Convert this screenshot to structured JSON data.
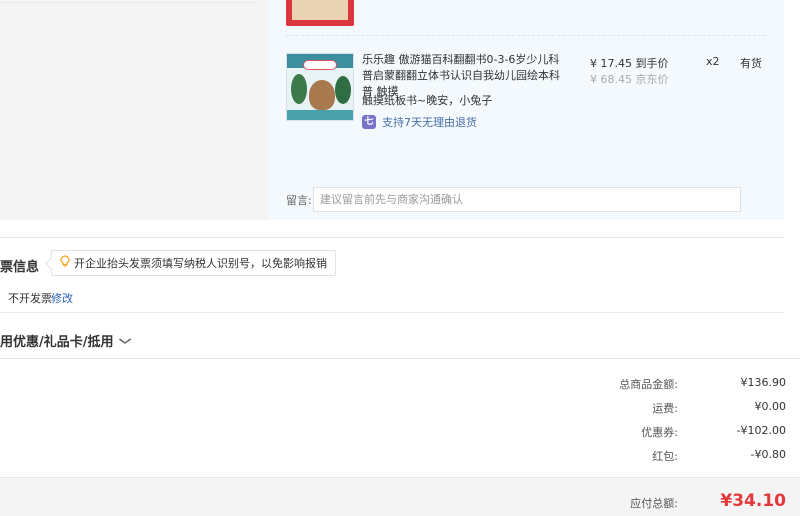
{
  "product": {
    "title": "乐乐趣 傲游猫百科翻翻书0-3-6岁少儿科普启蒙翻翻立体书认识自我幼儿园绘本科普 触摸",
    "spec": "触摸纸板书~晚安，小兔子",
    "return_policy": "支持7天无理由退货",
    "return_icon": "七",
    "price": "¥ 17.45",
    "price_tag": "到手价",
    "original_price": "¥ 68.45",
    "original_tag": "京东价",
    "quantity": "x2",
    "stock": "有货"
  },
  "remark": {
    "label": "留言:",
    "placeholder": "建议留言前先与商家沟通确认"
  },
  "invoice": {
    "title": "发票信息",
    "tip": "开企业抬头发票须填写纳税人识别号，以免影响报销",
    "status": "不开发票",
    "edit_label": "修改"
  },
  "coupon": {
    "label": "使用优惠/礼品卡/抵用"
  },
  "summary": {
    "total_goods_label": "总商品金额:",
    "total_goods_value": "¥136.90",
    "shipping_label": "运费:",
    "shipping_value": "¥0.00",
    "coupon_label": "优惠券:",
    "coupon_value": "-¥102.00",
    "redpacket_label": "红包:",
    "redpacket_value": "-¥0.80",
    "payable_label": "应付总额:",
    "payable_value": "¥34.10"
  },
  "colors": {
    "accent_red": "#e4393c",
    "link_blue": "#2a62b3",
    "panel_bg": "#f3f9fd"
  }
}
